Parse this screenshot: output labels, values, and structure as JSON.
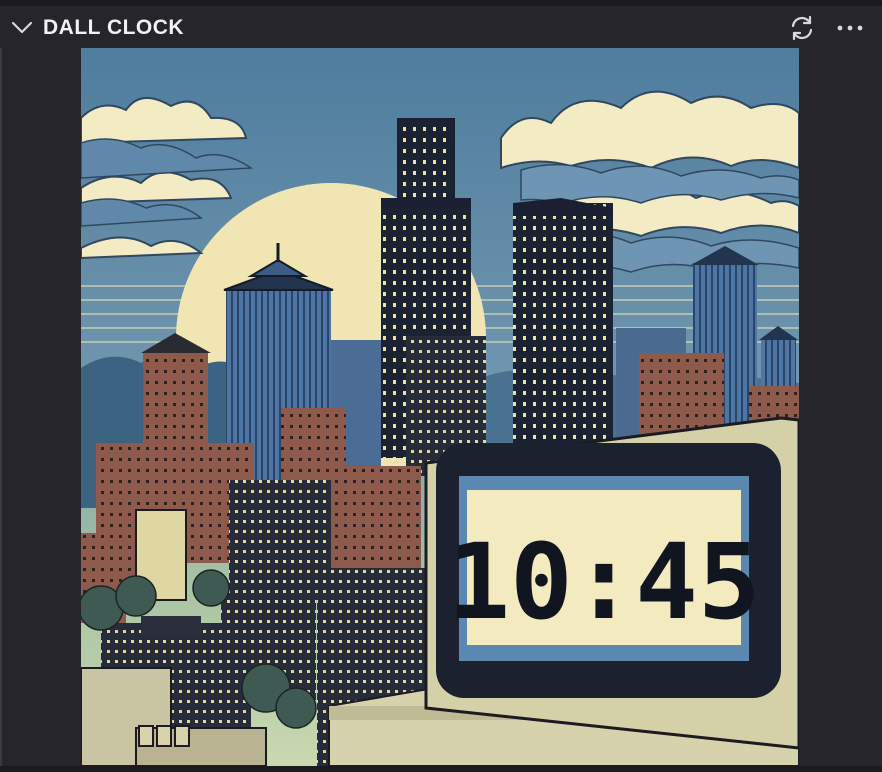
{
  "header": {
    "title": "DALL CLOCK",
    "collapse_icon": "chevron-down-icon",
    "refresh_icon": "refresh-icon",
    "more_icon": "more-horizontal-icon"
  },
  "image": {
    "clock_time": "10:45"
  },
  "colors": {
    "panel_bg": "#25252b",
    "title_text": "#f2f2f2",
    "sky": "#5a86a8",
    "sun": "#f0e4b0",
    "clock_screen": "#f3eac0",
    "clock_frame": "#1c2130"
  }
}
